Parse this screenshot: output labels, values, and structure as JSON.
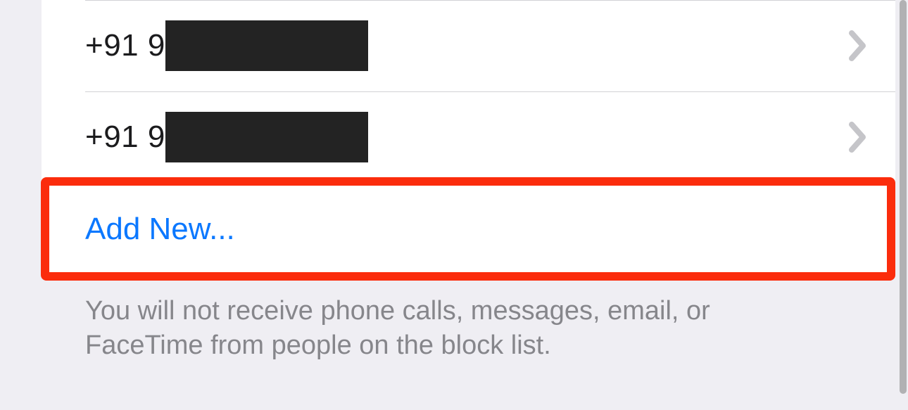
{
  "blocked": {
    "items": [
      {
        "prefix": "+91 9"
      },
      {
        "prefix": "+91 9"
      }
    ],
    "add_label": "Add New...",
    "footer": "You will not receive phone calls, messages, email, or FaceTime from people on the block list."
  }
}
